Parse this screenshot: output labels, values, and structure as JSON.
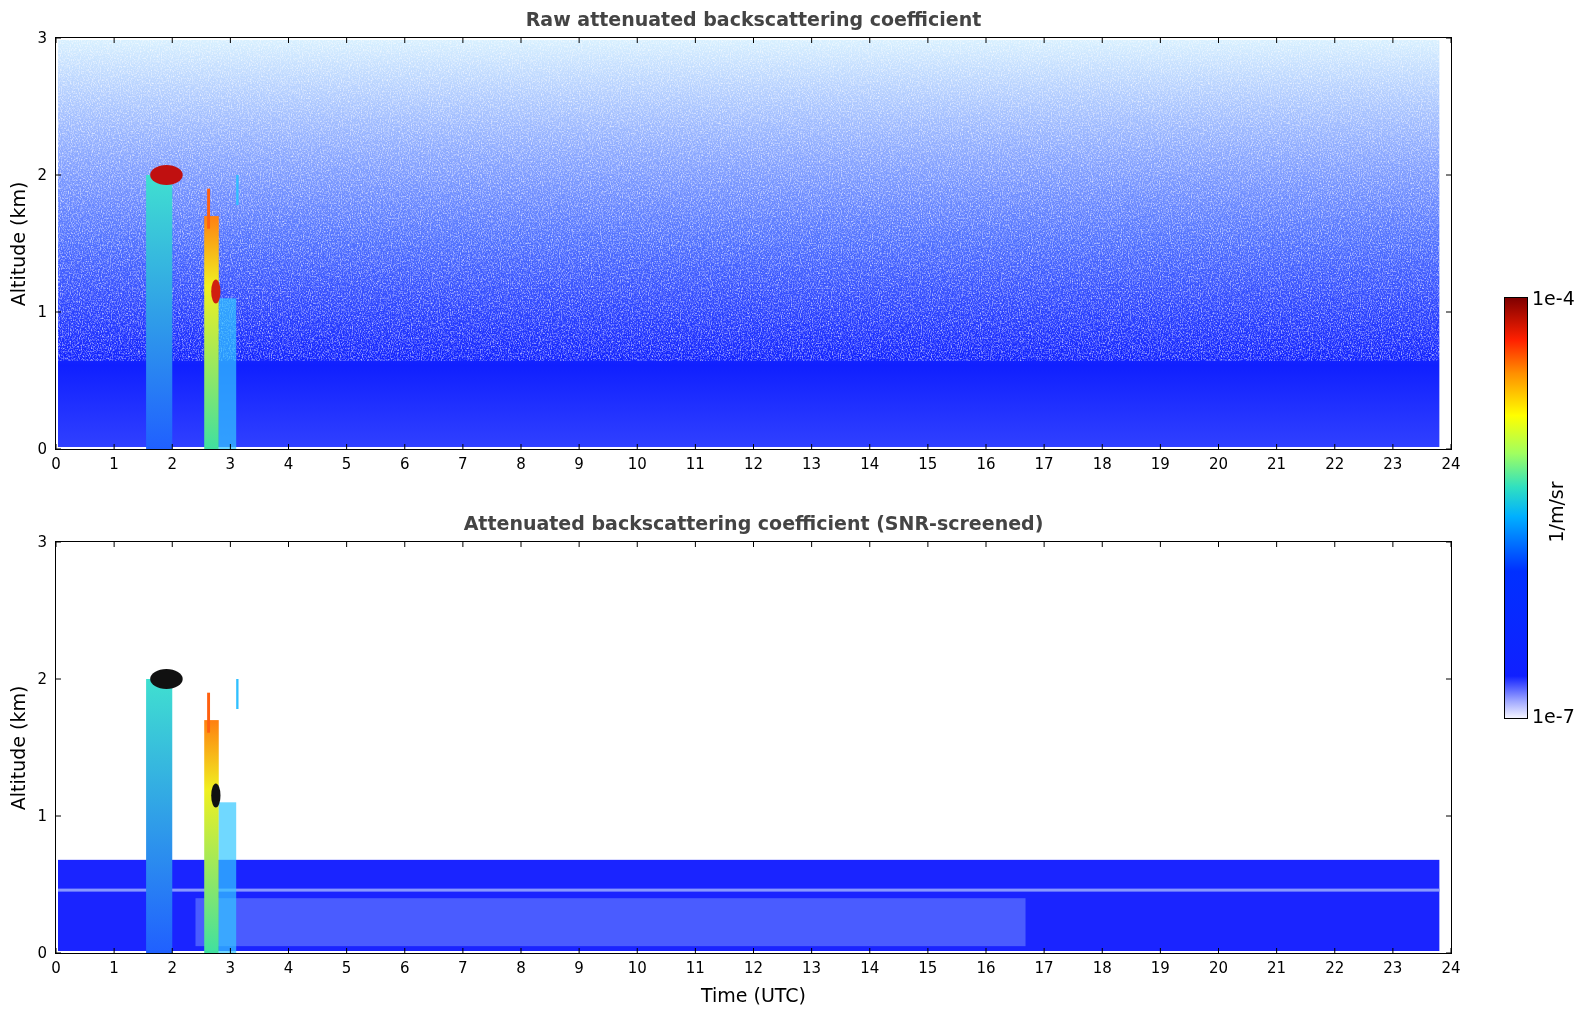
{
  "panels": [
    {
      "kind": "raw",
      "title": "Raw attenuated backscattering coefficient",
      "ylabel": "Altitude (km)",
      "yticks": [
        "3",
        "2",
        "1",
        "0"
      ],
      "xticks": [
        "0",
        "1",
        "2",
        "3",
        "4",
        "5",
        "6",
        "7",
        "8",
        "9",
        "10",
        "11",
        "12",
        "13",
        "14",
        "15",
        "16",
        "17",
        "18",
        "19",
        "20",
        "21",
        "22",
        "23",
        "24"
      ]
    },
    {
      "kind": "screened",
      "title": "Attenuated backscattering coefficient (SNR-screened)",
      "ylabel": "Altitude (km)",
      "yticks": [
        "3",
        "2",
        "1",
        "0"
      ],
      "xticks": [
        "0",
        "1",
        "2",
        "3",
        "4",
        "5",
        "6",
        "7",
        "8",
        "9",
        "10",
        "11",
        "12",
        "13",
        "14",
        "15",
        "16",
        "17",
        "18",
        "19",
        "20",
        "21",
        "22",
        "23",
        "24"
      ],
      "xlabel": "Time (UTC)"
    }
  ],
  "colorbar": {
    "max_label": "1e-4",
    "min_label": "1e-7",
    "unit": "1/m/sr"
  }
}
